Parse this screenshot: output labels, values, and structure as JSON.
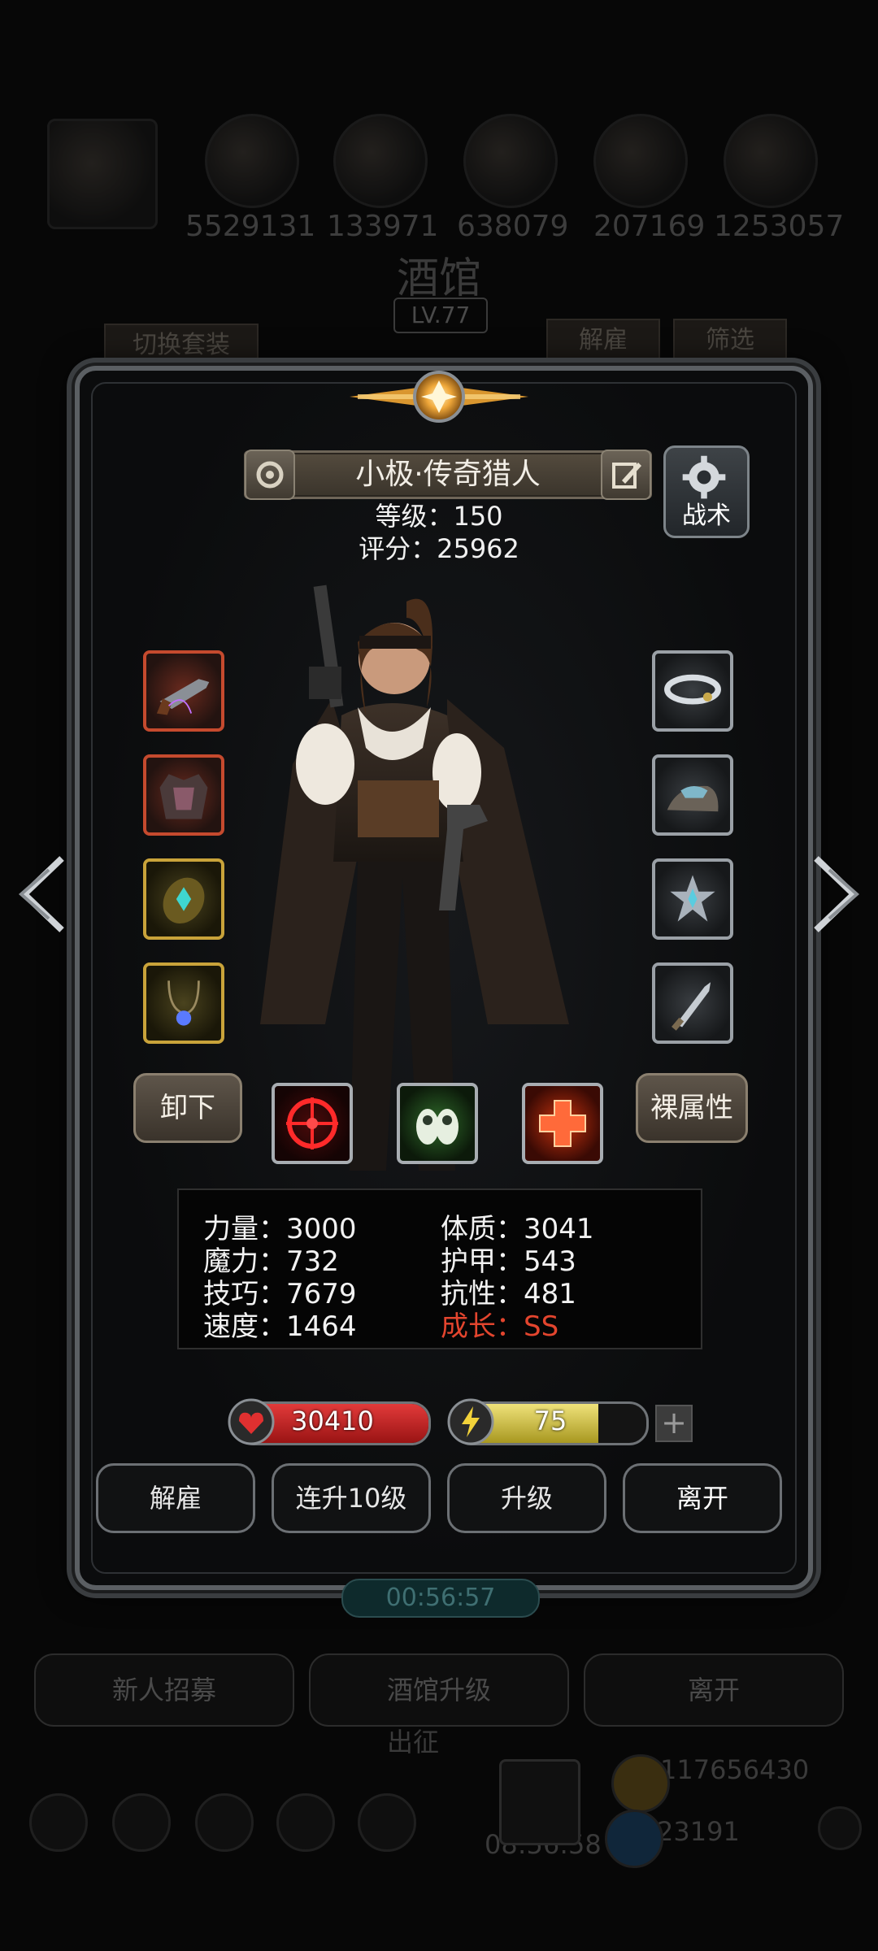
{
  "background": {
    "top_counts": [
      "5529131",
      "133971",
      "638079",
      "207169",
      "1253057"
    ],
    "title": "酒馆",
    "level": "LV.77",
    "switch_set_label": "切换套装",
    "dismiss_label": "解雇",
    "filter_label": "筛选",
    "timer": "00:56:57",
    "bottom_buttons": [
      "新人招募",
      "酒馆升级",
      "离开"
    ],
    "depart_label": "出征",
    "bottom_timer": "08:56:58",
    "gold_amount": "117656430",
    "gem_amount": "23191"
  },
  "hero": {
    "name": "小极·传奇猎人",
    "level_label": "等级：150",
    "score_label": "评分：25962",
    "tactics_label": "战术"
  },
  "equipment": {
    "left_slots": [
      "pistol",
      "armor",
      "amulet-gem",
      "necklace"
    ],
    "right_slots": [
      "cloud-ring",
      "crystal-stone",
      "crest-emblem",
      "dagger"
    ]
  },
  "actions": {
    "unequip_label": "卸下",
    "bare_stats_label": "裸属性"
  },
  "skills": [
    "target-skill",
    "spirit-skill",
    "heal-skill"
  ],
  "stats": {
    "left": [
      "力量：3000",
      "魔力：732",
      "技巧：7679",
      "速度：1464"
    ],
    "right": [
      "体质：3041",
      "护甲：543",
      "抗性：481"
    ],
    "growth": "成长：SS"
  },
  "bars": {
    "hp_value": "30410",
    "hp_fill": 1.0,
    "energy_value": "75",
    "energy_fill": 0.75,
    "plus": "+"
  },
  "bottom_actions": [
    "解雇",
    "连升10级",
    "升级",
    "离开"
  ],
  "colors": {
    "hp": "#c81e1e",
    "energy": "#d9c93a",
    "growth": "#e3452e"
  }
}
